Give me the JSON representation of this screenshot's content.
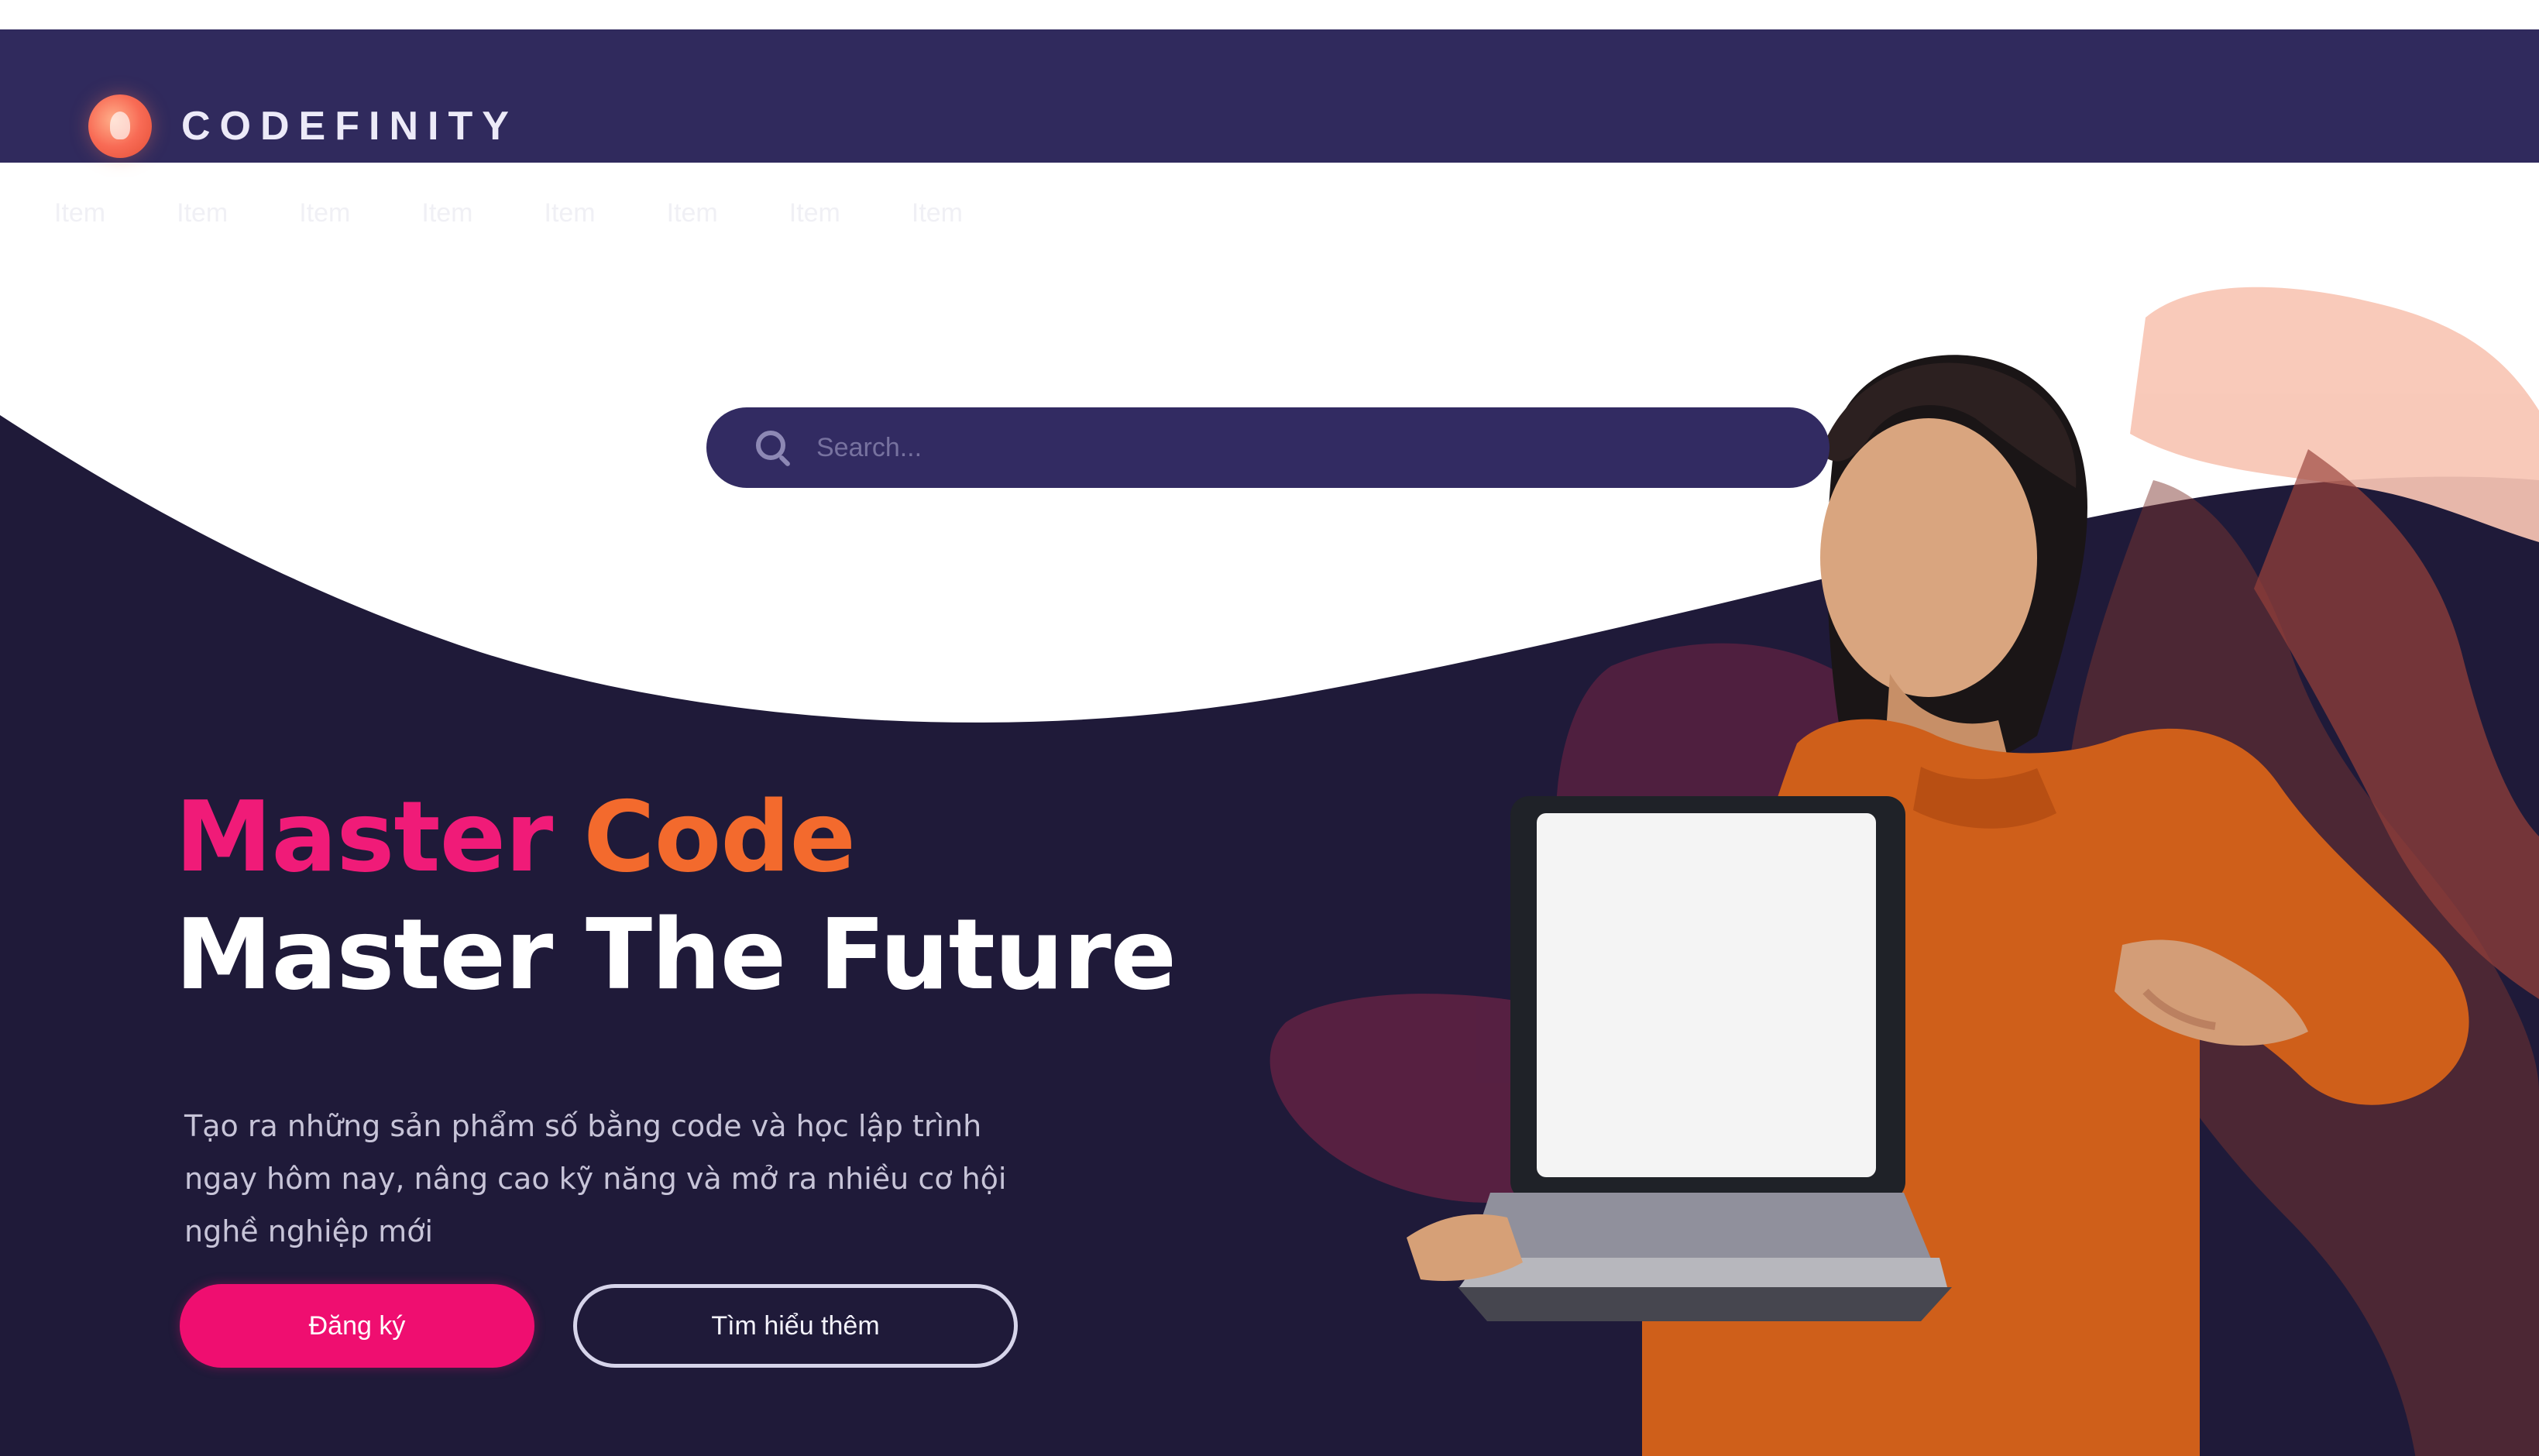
{
  "brand": {
    "name": "CODEFINITY",
    "mark_icon": "logo-mark"
  },
  "nav": {
    "items": [
      {
        "label": "Item"
      },
      {
        "label": "Item"
      },
      {
        "label": "Item"
      },
      {
        "label": "Item"
      },
      {
        "label": "Item"
      },
      {
        "label": "Item"
      },
      {
        "label": "Item"
      },
      {
        "label": "Item"
      }
    ]
  },
  "search": {
    "placeholder": "Search..."
  },
  "hero": {
    "headline_line1_a": "Master",
    "headline_line1_b": "Code",
    "headline_line2": "Master The Future",
    "description_lines": [
      "Tạo ra những sản phẩm số bằng code và học lập trình",
      "ngay hôm nay, nâng cao kỹ năng và mở ra nhiều cơ hội",
      "nghề nghiệp mới"
    ],
    "primary_button": "Đăng ký",
    "secondary_button": "Tìm hiểu thêm"
  },
  "colors": {
    "header_bg": "#302a5d",
    "hero_bg": "#1f1a39",
    "primary_pink": "#ef0e70",
    "accent_orange": "#f36a2d",
    "white": "#ffffff"
  }
}
